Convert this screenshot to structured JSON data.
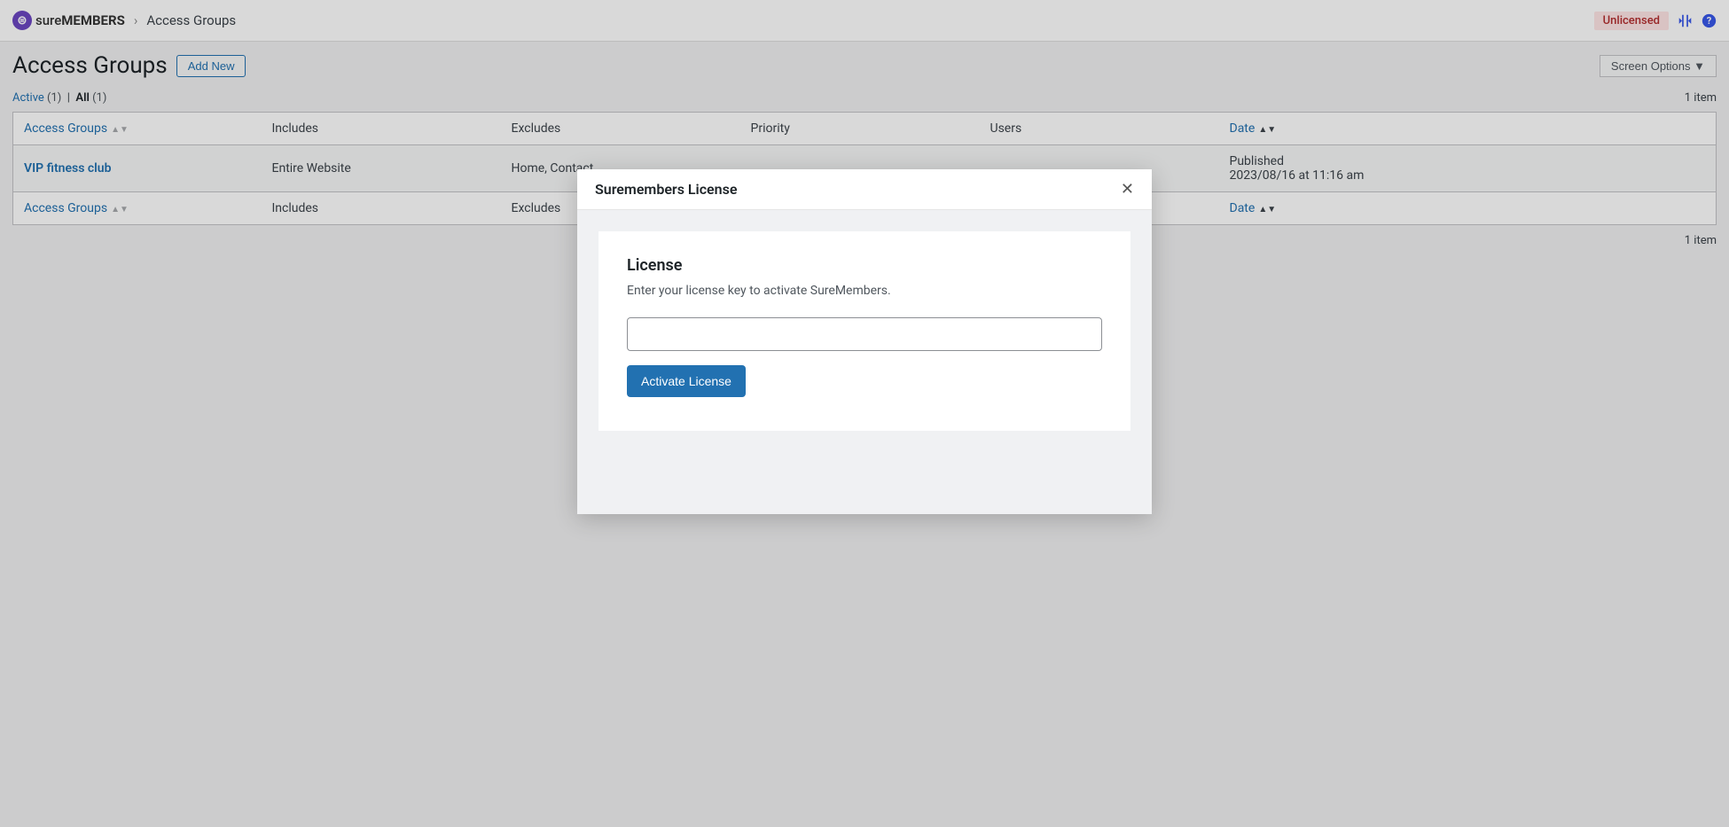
{
  "topbar": {
    "logo_prefix": "sure",
    "logo_suffix": "MEMBERS",
    "breadcrumb_current": "Access Groups",
    "unlicensed_badge": "Unlicensed"
  },
  "page": {
    "title": "Access Groups",
    "add_new": "Add New",
    "screen_options": "Screen Options"
  },
  "filters": {
    "active_label": "Active",
    "active_count": "(1)",
    "all_label": "All",
    "all_count": "(1)",
    "item_count_top": "1 item",
    "item_count_bottom": "1 item"
  },
  "columns": {
    "access_groups": "Access Groups",
    "includes": "Includes",
    "excludes": "Excludes",
    "priority": "Priority",
    "users": "Users",
    "date": "Date"
  },
  "rows": [
    {
      "title": "VIP fitness club",
      "includes": "Entire Website",
      "excludes": "Home, Contact",
      "priority": "",
      "users": "",
      "date_status": "Published",
      "date_value": "2023/08/16 at 11:16 am"
    }
  ],
  "modal": {
    "title": "Suremembers License",
    "card_heading": "License",
    "card_text": "Enter your license key to activate SureMembers.",
    "input_placeholder": "",
    "activate_label": "Activate License"
  }
}
